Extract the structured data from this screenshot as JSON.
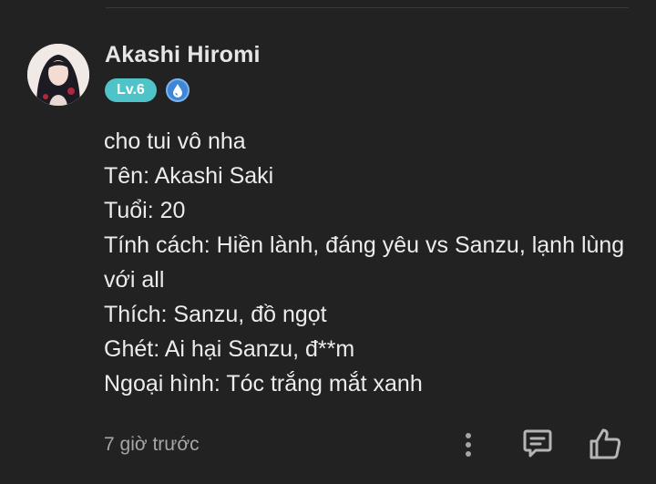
{
  "comment": {
    "author": {
      "name": "Akashi Hiromi",
      "level_badge": "Lv.6",
      "badge_icon": "water-drop-icon",
      "avatar": "user-avatar"
    },
    "lines": [
      "cho tui vô nha",
      "Tên: Akashi Saki",
      "Tuổi: 20",
      "Tính cách: Hiền lành, đáng yêu vs Sanzu, lạnh lùng",
      "với all",
      "Thích: Sanzu, đồ ngọt",
      "Ghét: Ai hại Sanzu, đ**m",
      "Ngoại hình: Tóc trắng mắt xanh"
    ],
    "timestamp": "7 giờ trước",
    "actions": {
      "more_icon": "more-vertical-icon",
      "reply_icon": "comment-icon",
      "like_icon": "thumbs-up-icon"
    }
  },
  "colors": {
    "background": "#222222",
    "level_badge": "#4fc3c7",
    "drop_badge": "#3f86d6",
    "text": "#ececec",
    "muted": "#a6a6a6"
  }
}
